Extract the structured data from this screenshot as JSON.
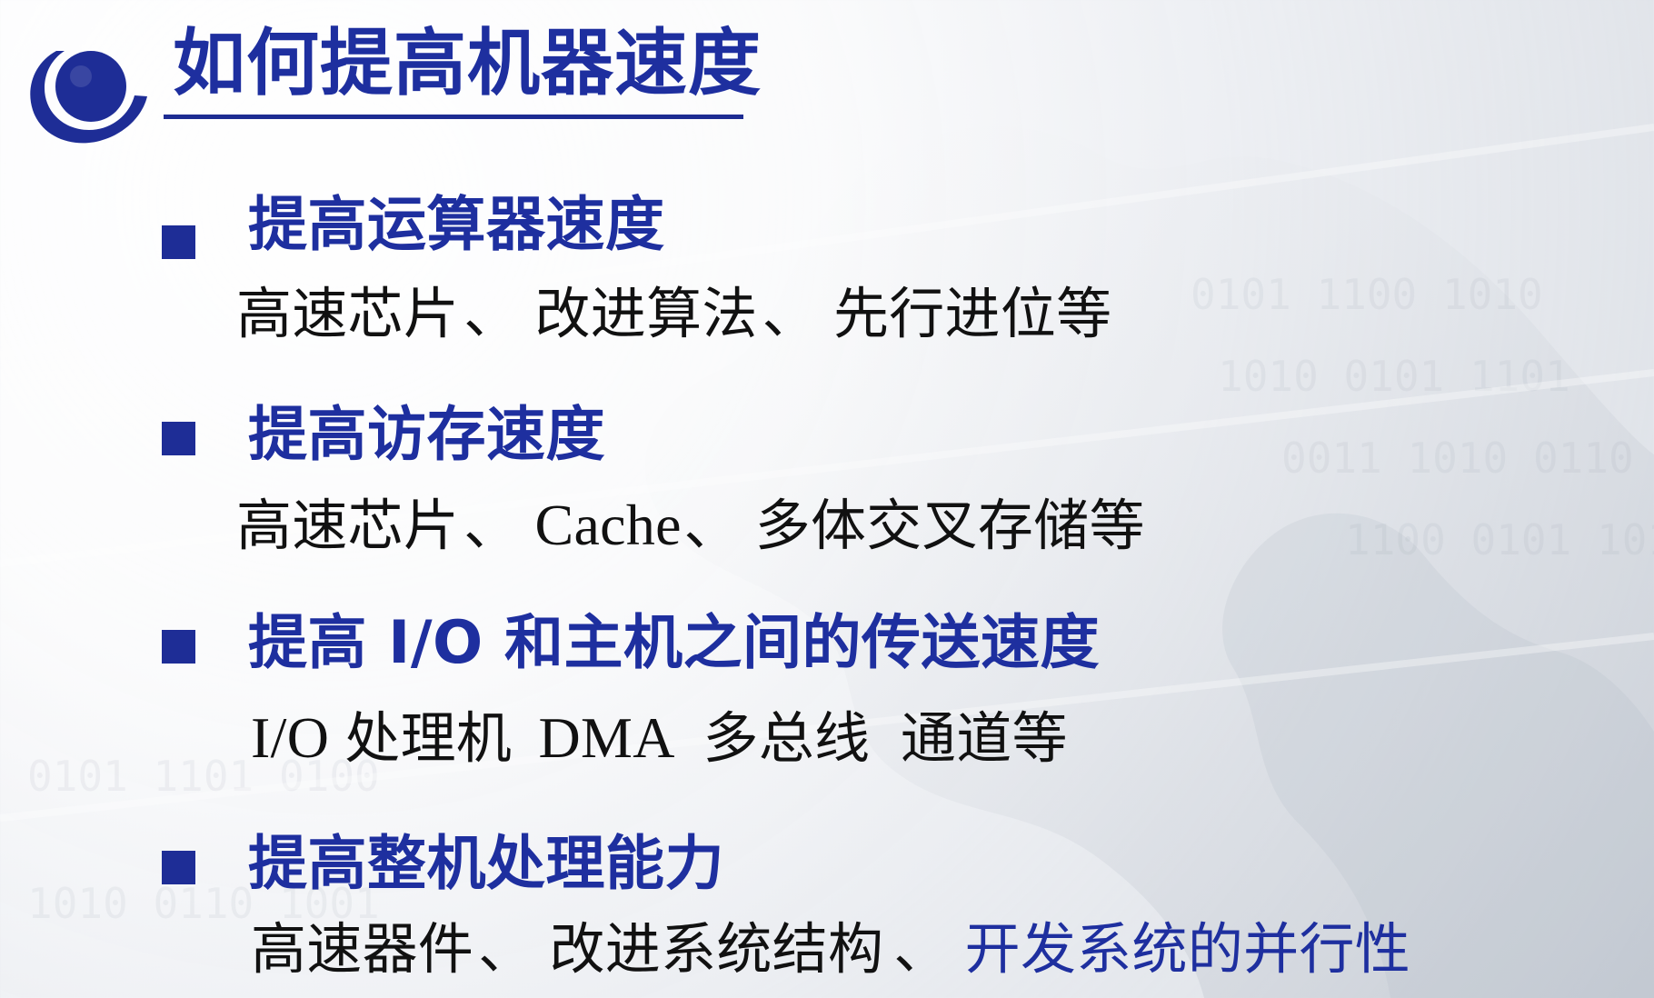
{
  "slide": {
    "title": "如何提高机器速度",
    "colors": {
      "title_blue": "#1e2f9f",
      "bullet_blue": "#1e2d96",
      "body_text": "#111111"
    },
    "logo_icon": "blue-circle-emblem-icon",
    "items": [
      {
        "heading": "提高运算器速度",
        "detail": [
          {
            "text": "高速芯片"
          },
          {
            "text": "、"
          },
          {
            "text": "改进算法"
          },
          {
            "text": "、"
          },
          {
            "text": "先行进位等"
          }
        ]
      },
      {
        "heading": "提高访存速度",
        "detail": [
          {
            "text": "高速芯片"
          },
          {
            "text": "、"
          },
          {
            "text": "Cache"
          },
          {
            "text": "、"
          },
          {
            "text": "多体交叉存储等"
          }
        ]
      },
      {
        "heading": "提高 I/O 和主机之间的传送速度",
        "detail": [
          {
            "text": "I/O"
          },
          {
            "text": "处理机"
          },
          {
            "text": "DMA"
          },
          {
            "text": "多总线"
          },
          {
            "text": "通道等"
          }
        ]
      },
      {
        "heading": "提高整机处理能力",
        "detail": [
          {
            "text": "高速器件"
          },
          {
            "text": "、"
          },
          {
            "text": "改进系统结构"
          },
          {
            "text": "、"
          },
          {
            "text": "开发系统的并行性"
          }
        ]
      }
    ]
  }
}
